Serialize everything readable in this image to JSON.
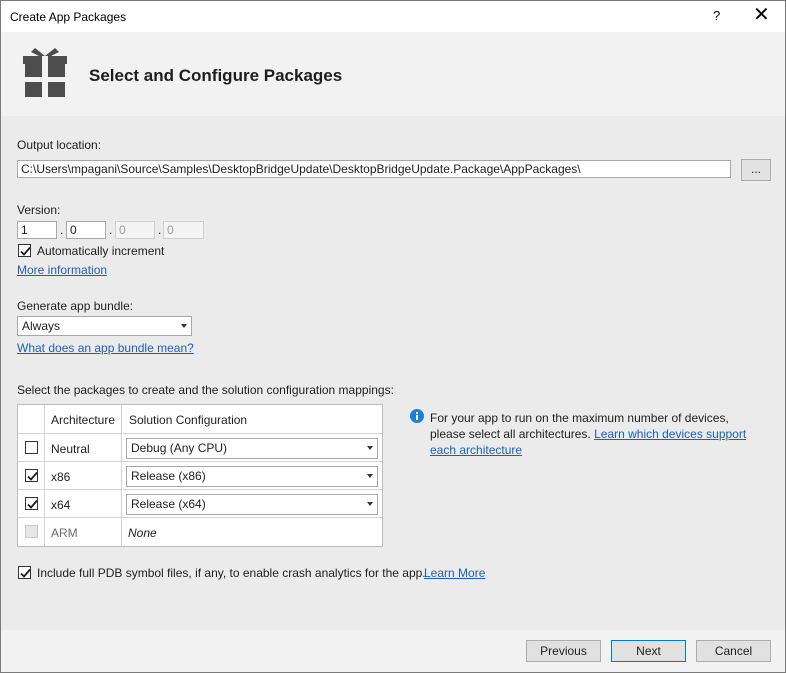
{
  "window": {
    "title": "Create App Packages",
    "help_glyph": "?",
    "close_glyph": "✕"
  },
  "header": {
    "heading": "Select and Configure Packages",
    "icon": "package-icon"
  },
  "output": {
    "label": "Output location:",
    "value": "C:\\Users\\mpagani\\Source\\Samples\\DesktopBridgeUpdate\\DesktopBridgeUpdate.Package\\AppPackages\\",
    "browse_label": "..."
  },
  "version": {
    "label": "Version:",
    "major": "1",
    "minor": "0",
    "build": "0",
    "revision": "0",
    "separator": ".",
    "auto_increment_label": "Automatically increment",
    "auto_increment_checked": true,
    "more_info_link": "More information"
  },
  "bundle": {
    "label": "Generate app bundle:",
    "selected": "Always",
    "help_link": "What does an app bundle mean?"
  },
  "packages": {
    "label": "Select the packages to create and the solution configuration mappings:",
    "columns": [
      "Architecture",
      "Solution Configuration"
    ],
    "rows": [
      {
        "checked": false,
        "enabled": true,
        "arch": "Neutral",
        "config": "Debug (Any CPU)"
      },
      {
        "checked": true,
        "enabled": true,
        "arch": "x86",
        "config": "Release (x86)"
      },
      {
        "checked": true,
        "enabled": true,
        "arch": "x64",
        "config": "Release (x64)"
      },
      {
        "checked": false,
        "enabled": false,
        "arch": "ARM",
        "config": "None"
      }
    ]
  },
  "info": {
    "icon": "info-icon",
    "text": "For your app to run on the maximum number of devices, please select all architectures.",
    "link": "Learn which devices support each architecture"
  },
  "pdb": {
    "checked": true,
    "label": "Include full PDB symbol files, if any, to enable crash analytics for the app.",
    "link": "Learn More"
  },
  "buttons": {
    "previous": "Previous",
    "next": "Next",
    "cancel": "Cancel"
  },
  "colors": {
    "link": "#1e5fb4",
    "accent": "#0078d7",
    "content_bg": "#ebebeb",
    "header_bg": "#f2f2f2"
  }
}
